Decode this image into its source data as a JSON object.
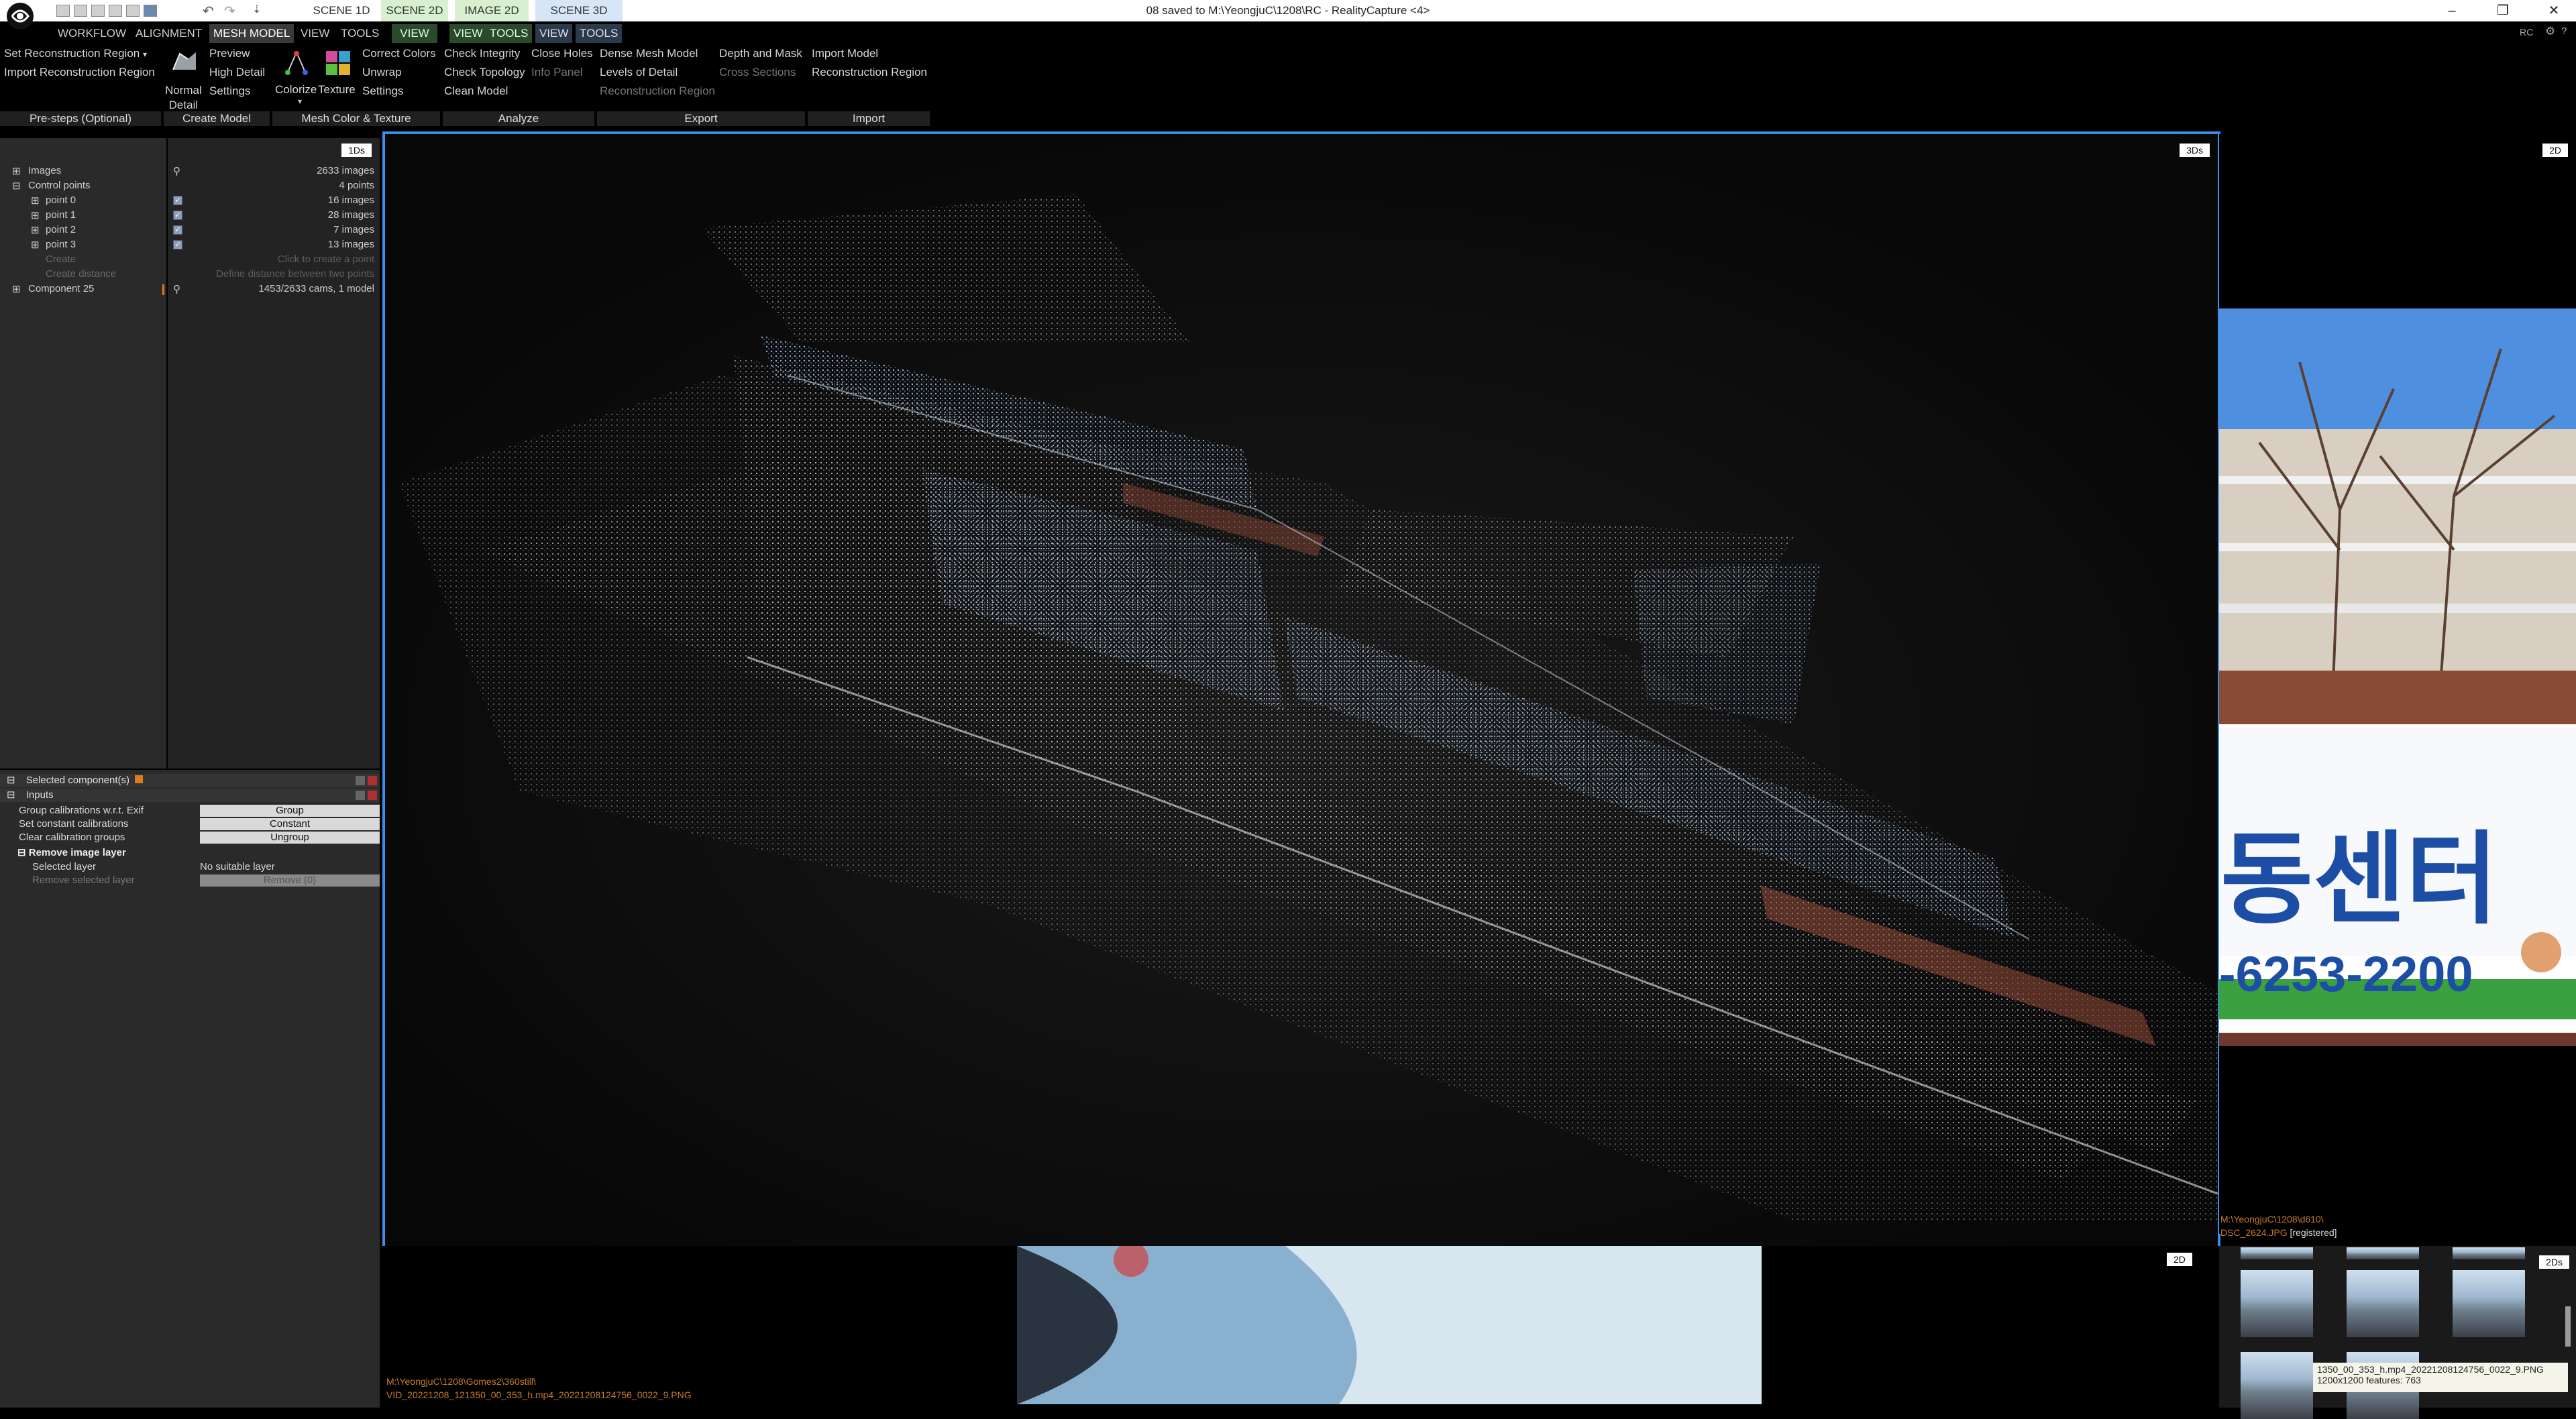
{
  "window": {
    "title": "08 saved to M:\\YeongjuC\\1208\\RC - RealityCapture <4>",
    "rc_badge": "RC"
  },
  "layout_tabs": [
    "SCENE 1D",
    "SCENE 2D",
    "IMAGE 2D",
    "SCENE 3D"
  ],
  "menu": {
    "items": [
      "WORKFLOW",
      "ALIGNMENT",
      "MESH MODEL",
      "VIEW",
      "TOOLS",
      "VIEW",
      "VIEW",
      "TOOLS",
      "VIEW",
      "TOOLS"
    ],
    "active": "MESH MODEL"
  },
  "ribbon": {
    "prestep": [
      "Set Reconstruction Region",
      "Import Reconstruction Region"
    ],
    "create": {
      "normal_detail": "Normal\nDetail",
      "preview": "Preview",
      "high_detail": "High Detail",
      "settings": "Settings"
    },
    "color": {
      "colorize": "Colorize",
      "texture": "Texture",
      "correct_colors": "Correct Colors",
      "unwrap": "Unwrap",
      "settings": "Settings"
    },
    "analyze": {
      "check_integrity": "Check Integrity",
      "check_topology": "Check Topology",
      "clean_model": "Clean Model",
      "close_holes": "Close Holes",
      "info_panel": "Info Panel"
    },
    "export": {
      "dense_mesh_model": "Dense Mesh Model",
      "levels_of_detail": "Levels of Detail",
      "reconstruction_region": "Reconstruction Region",
      "depth_and_mask": "Depth and Mask",
      "cross_sections": "Cross Sections"
    },
    "import": {
      "import_model": "Import Model",
      "reconstruction_region": "Reconstruction Region"
    },
    "groups": [
      "Pre-steps (Optional)",
      "Create Model",
      "Mesh Color & Texture",
      "Analyze",
      "Export",
      "Import"
    ]
  },
  "panel_1ds": {
    "badge": "1Ds",
    "tree": [
      {
        "label": "Images",
        "value": "2633 images"
      },
      {
        "label": "Control points",
        "value": "4 points"
      },
      {
        "label": "point 0",
        "value": "16 images"
      },
      {
        "label": "point 1",
        "value": "28 images"
      },
      {
        "label": "point 2",
        "value": "7 images"
      },
      {
        "label": "point 3",
        "value": "13 images"
      },
      {
        "label": "Create",
        "value": "Click to create a point"
      },
      {
        "label": "Create distance",
        "value": "Define distance between two points"
      },
      {
        "label": "Component 25",
        "value": "1453/2633 cams, 1 model"
      }
    ]
  },
  "inspector": {
    "selected_header": "Selected component(s)",
    "inputs_header": "Inputs",
    "properties": [
      {
        "label": "Group calibrations w.r.t. Exif",
        "button": "Group"
      },
      {
        "label": "Set constant calibrations",
        "button": "Constant"
      },
      {
        "label": "Clear calibration groups",
        "button": "Ungroup"
      }
    ],
    "remove_section": "Remove image layer",
    "selected_layer_label": "Selected layer",
    "selected_layer_value": "No suitable layer",
    "remove_label": "Remove selected layer",
    "remove_button": "Remove (0)"
  },
  "view3d": {
    "badge": "3Ds"
  },
  "view2d_right": {
    "badge": "2D",
    "sign_text": "동센터",
    "sign_phone": "-6253-2200",
    "caption_path": "M:\\YeongjuC\\1208\\d610\\",
    "caption_file": "DSC_2624.JPG",
    "caption_status": "[registered]"
  },
  "view2d_bottom": {
    "badge": "2D",
    "caption_path": "M:\\YeongjuC\\1208\\Gomes2\\360still\\",
    "caption_file": "VID_20221208_121350_00_353_h.mp4_20221208124756_0022_9.PNG"
  },
  "thumbs": {
    "badge": "2Ds",
    "tooltip_line1": "1350_00_353_h.mp4_20221208124756_0022_9.PNG",
    "tooltip_line2": "1200x1200 features: 763"
  }
}
